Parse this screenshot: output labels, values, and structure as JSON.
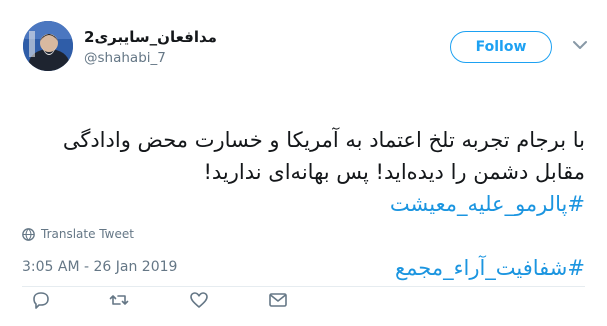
{
  "user": {
    "display_name": "مدافعان_سایبری2",
    "handle": "@shahabi_7",
    "avatar_icon": "profile-photo"
  },
  "follow_label": "Follow",
  "tweet": {
    "line1": "با برجام تجربه تلخ اعتماد به آمریکا و خسارت محض وادادگی مقابل دشمن را دیده‌اید! پس بهانه‌ای ندارید!",
    "hashtag1": "#پالرمو_علیه_معیشت",
    "hashtag2": "#شفافیت_آراء_مجمع"
  },
  "translate_label": "Translate Tweet",
  "timestamp": "3:05 AM - 26 Jan 2019",
  "colors": {
    "accent": "#1da1f2",
    "link": "#1b95e0",
    "muted": "#657786"
  },
  "actions": [
    "reply-icon",
    "retweet-icon",
    "like-icon",
    "message-icon"
  ]
}
